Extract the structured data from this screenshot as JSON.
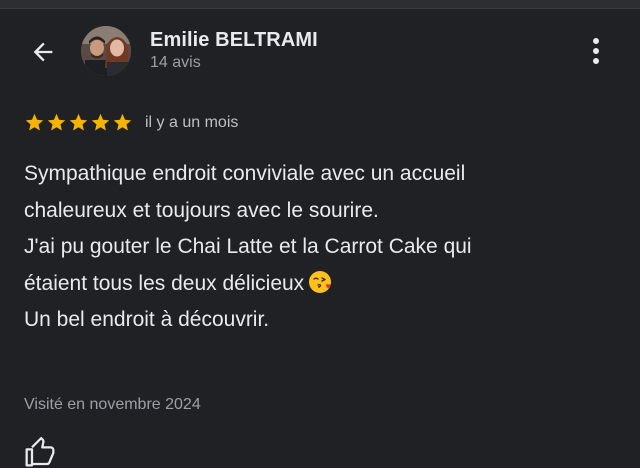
{
  "header": {
    "back_icon": "arrow-left-icon",
    "reviewer_name": "Emilie BELTRAMI",
    "review_count": "14 avis",
    "more_icon": "more-vert-icon"
  },
  "review": {
    "rating": 5,
    "rating_max": 5,
    "star_color": "#f4b400",
    "date": "il y a un mois",
    "lines": [
      "Sympathique endroit conviviale avec un accueil",
      "chaleureux et toujours avec le sourire.",
      "J'ai pu gouter le Chai Latte et la Carrot Cake qui",
      "étaient tous les deux délicieux",
      "",
      "Un bel endroit à découvrir."
    ],
    "emoji": "face-blowing-kiss-emoji",
    "visit_info": "Visité en novembre 2024"
  },
  "actions": {
    "like_icon": "thumb-up-icon"
  }
}
